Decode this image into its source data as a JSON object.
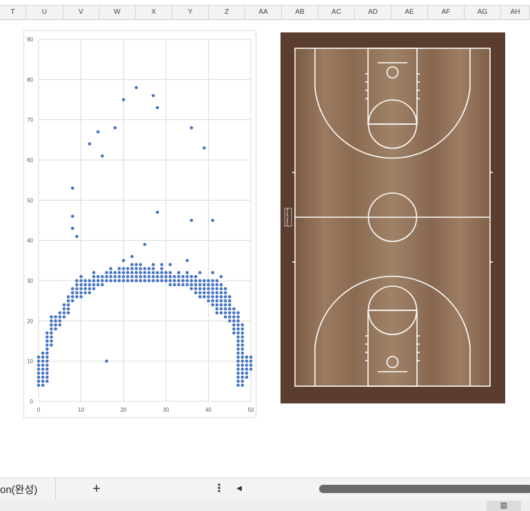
{
  "columns": [
    "T",
    "U",
    "V",
    "W",
    "X",
    "Y",
    "Z",
    "AA",
    "AB",
    "AC",
    "AD",
    "AE",
    "AF",
    "AG",
    "AH"
  ],
  "sheet_tab": {
    "label": "on(완성)"
  },
  "tabbar": {
    "add_label": "+",
    "more_label": "⋮",
    "scroll_left": "◀"
  },
  "statusbar": {
    "view_icon": "▥"
  },
  "court": {
    "side_label": "[Visitor]\nBench",
    "wood_color": "#8a6b52",
    "frame_color": "#5b3d2e",
    "line_color": "#ffffff"
  },
  "chart_data": {
    "type": "scatter",
    "xlim": [
      0,
      50
    ],
    "ylim": [
      0,
      90
    ],
    "x_ticks": [
      0,
      10,
      20,
      30,
      40,
      50
    ],
    "y_ticks": [
      0,
      10,
      20,
      30,
      40,
      50,
      60,
      70,
      80,
      90
    ],
    "grid": true,
    "marker_color": "#4472c4",
    "outliers": [
      [
        3,
        19
      ],
      [
        8,
        53
      ],
      [
        8,
        46
      ],
      [
        8,
        43
      ],
      [
        9,
        41
      ],
      [
        12,
        64
      ],
      [
        14,
        67
      ],
      [
        15,
        61
      ],
      [
        18,
        68
      ],
      [
        20,
        75
      ],
      [
        23,
        78
      ],
      [
        27,
        76
      ],
      [
        28,
        73
      ],
      [
        36,
        68
      ],
      [
        39,
        63
      ],
      [
        28,
        47
      ],
      [
        36,
        45
      ],
      [
        41,
        45
      ],
      [
        25,
        39
      ],
      [
        16,
        10
      ],
      [
        20,
        35
      ],
      [
        22,
        36
      ],
      [
        27,
        34
      ],
      [
        29,
        34
      ],
      [
        31,
        34
      ],
      [
        33,
        32
      ],
      [
        35,
        35
      ],
      [
        37,
        31
      ],
      [
        38,
        32
      ],
      [
        41,
        32
      ],
      [
        43,
        31
      ]
    ],
    "cluster": {
      "rows": [
        31,
        30,
        29,
        28,
        27,
        26,
        25,
        24,
        23,
        22,
        21,
        20,
        19,
        18,
        17,
        16,
        15,
        14,
        13,
        12,
        11,
        10,
        9,
        8,
        7,
        6,
        5,
        4
      ],
      "arc": {
        "left_x": [
          1,
          3,
          5,
          8,
          11,
          14,
          17,
          20,
          23,
          26,
          29,
          32,
          35,
          38,
          40,
          42,
          44,
          46,
          47,
          48
        ],
        "base": 30
      }
    }
  }
}
